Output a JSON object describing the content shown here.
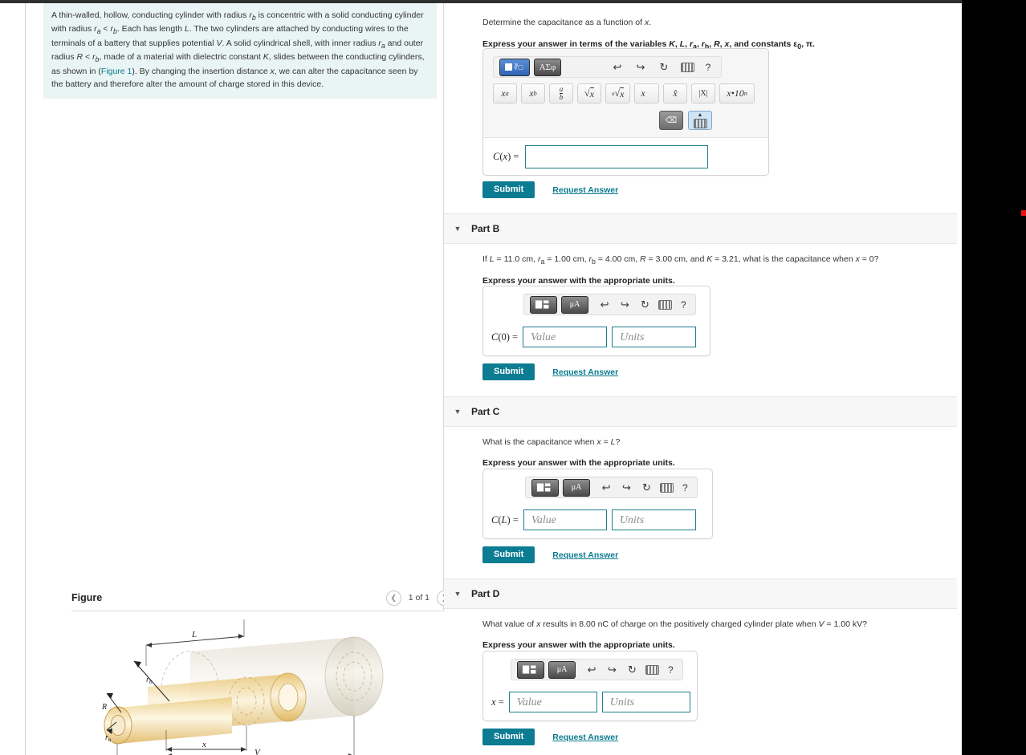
{
  "problem": {
    "statement_html": "A thin-walled, hollow, conducting cylinder with radius <i>r<sub>b</sub></i> is concentric with a solid conducting cylinder with radius <i>r<sub>a</sub></i> &lt; <i>r<sub>b</sub></i>. Each has length <i>L</i>. The two cylinders are attached by conducting wires to the terminals of a battery that supplies potential <i>V</i>. A solid cylindrical shell, with inner radius <i>r<sub>a</sub></i> and outer radius <i>R</i> &lt; <i>r<sub>b</sub></i>, made of a material with dielectric constant <i>K</i>, slides between the conducting cylinders, as shown in (<a>Figure 1</a>). By changing the insertion distance <i>x</i>, we can alter the capacitance seen by the battery and therefore alter the amount of charge stored in this device.",
    "figure_link_label": "Figure 1"
  },
  "figure": {
    "title": "Figure",
    "counter": "1 of 1",
    "prev_icon": "chevron-left-icon",
    "next_icon": "chevron-right-icon",
    "labels": {
      "length": "L",
      "outer_radius": "r_b",
      "shell_radius": "R",
      "inner_radius": "r_a",
      "insertion": "x",
      "potential": "V"
    }
  },
  "toolbar": {
    "math_template_icon": "math-template-icon",
    "greek_label": "ΑΣφ",
    "units_template_icon": "units-template-icon",
    "micro_label": "μA",
    "undo_icon": "undo-icon",
    "redo_icon": "redo-icon",
    "reset_icon": "reset-icon",
    "keyboard_icon": "keyboard-icon",
    "help_label": "?",
    "backspace_icon": "backspace-icon",
    "hide-keyboard_icon": "hide-keyboard-icon",
    "symbols": [
      "x^a",
      "x_b",
      "a/b",
      "sqrt(x)",
      "nth-root(x)",
      "vec(x)",
      "hat(x)",
      "|x|",
      "x*10^n"
    ]
  },
  "actions": {
    "submit_label": "Submit",
    "request_answer_label": "Request Answer"
  },
  "parts": [
    {
      "id": "A",
      "prompt_html": "Determine the capacitance as a function of <i>x</i>.",
      "instruction_html": "Express your answer in terms of the variables <i>K</i>, <i>L</i>, <i>r</i><sub>a</sub>, <i>r</i><sub>b</sub>, <i>R</i>, <i>x</i>, and constants <span style=\"font-style:normal\">&epsilon;</span><sub>0</sub>, &pi;.",
      "answer_label_html": "<i>C</i>(<i>x</i>) =",
      "input_kind": "expression",
      "value": "",
      "placeholder_value": "",
      "placeholder_units": ""
    },
    {
      "id": "B",
      "header_label": "Part B",
      "prompt_html": "If <i>L</i> = 11.0 cm, <i>r</i><sub>a</sub> = 1.00 cm, <i>r</i><sub>b</sub> = 4.00 cm, <i>R</i> = 3.00 cm, and <i>K</i> = 3.21, what is the capacitance when <i>x</i> = 0?",
      "instruction_html": "Express your answer with the appropriate units.",
      "answer_label_html": "<i>C</i>(0) =",
      "input_kind": "value-units",
      "placeholder_value": "Value",
      "placeholder_units": "Units",
      "givens": {
        "L": "11.0 cm",
        "r_a": "1.00 cm",
        "r_b": "4.00 cm",
        "R": "3.00 cm",
        "K": "3.21",
        "x": "0"
      }
    },
    {
      "id": "C",
      "header_label": "Part C",
      "prompt_html": "What is the capacitance when <i>x</i> = <i>L</i>?",
      "instruction_html": "Express your answer with the appropriate units.",
      "answer_label_html": "<i>C</i>(<i>L</i>) =",
      "input_kind": "value-units",
      "placeholder_value": "Value",
      "placeholder_units": "Units"
    },
    {
      "id": "D",
      "header_label": "Part D",
      "prompt_html": "What value of <i>x</i> results in 8.00 nC of charge on the positively charged cylinder plate when <i>V</i> = 1.00 kV?",
      "instruction_html": "Express your answer with the appropriate units.",
      "answer_label_html": "<i>x</i> =",
      "input_kind": "value-units",
      "placeholder_value": "Value",
      "placeholder_units": "Units",
      "givens": {
        "Q": "8.00 nC",
        "V": "1.00 kV"
      }
    }
  ],
  "colors": {
    "accent_teal": "#0c7c93",
    "intro_bg": "#e9f5f4",
    "part_header_bg": "#f7f7f7",
    "marker_red": "#ee1111"
  }
}
